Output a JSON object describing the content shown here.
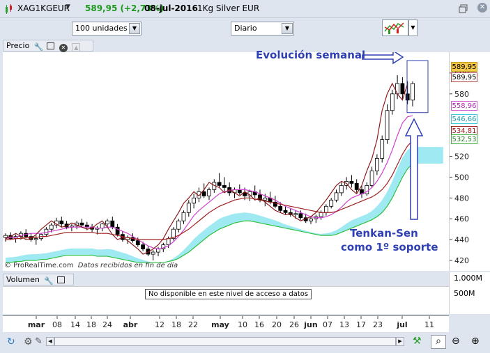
{
  "title": {
    "symbol": "XAG1KGEUR",
    "change": "589,95 (+2,73%)",
    "date": "08-jul-2016",
    "name": "1Kg Silver EUR"
  },
  "toolbar": {
    "units_select": "100 unidades",
    "period_select": "Diario"
  },
  "price_panel": {
    "label": "Precio",
    "watermark": "© ProRealTime.com",
    "watermark_note": "Datos recibidos en fin de día",
    "annotation_weekly": "Evolución semanal",
    "annotation_tenkan_line1": "Tenkan-Sen",
    "annotation_tenkan_line2": "como 1º soporte",
    "price_tags": [
      {
        "text": "589,95",
        "bg": "#f6c84a",
        "border": "#c89a1c",
        "color": "#000"
      },
      {
        "text": "589,95",
        "bg": "#ffffff",
        "border": "#b04848",
        "color": "#000"
      },
      {
        "text": "558,96",
        "bg": "#ffffff",
        "border": "#d060d0",
        "color": "#b030b0"
      },
      {
        "text": "546,66",
        "bg": "#ffffff",
        "border": "#40c8d8",
        "color": "#20a0b0"
      },
      {
        "text": "534,81",
        "bg": "#ffffff",
        "border": "#a02020",
        "color": "#a02020"
      },
      {
        "text": "532,53",
        "bg": "#ffffff",
        "border": "#40b040",
        "color": "#208020"
      }
    ]
  },
  "volume_panel": {
    "label": "Volumen",
    "message": "No disponible en este nivel de acceso a datos",
    "y_labels": [
      "1.000M",
      "500M"
    ]
  },
  "chart_data": {
    "type": "candlestick",
    "title": "",
    "ylim": [
      410,
      620
    ],
    "y_ticks": [
      420,
      440,
      460,
      480,
      500,
      520,
      580,
      600
    ],
    "x_ticks": [
      "mar",
      "08",
      "14",
      "18",
      "24",
      "abr",
      "12",
      "18",
      "22",
      "may",
      "10",
      "16",
      "20",
      "26",
      "jun",
      "07",
      "13",
      "17",
      "23",
      "jul",
      "11"
    ],
    "grid": false,
    "ohlc": [
      [
        442,
        446,
        438,
        444
      ],
      [
        444,
        447,
        440,
        441
      ],
      [
        441,
        445,
        437,
        443
      ],
      [
        443,
        448,
        440,
        446
      ],
      [
        446,
        450,
        441,
        443
      ],
      [
        443,
        446,
        438,
        440
      ],
      [
        440,
        444,
        435,
        441
      ],
      [
        441,
        446,
        439,
        445
      ],
      [
        445,
        452,
        443,
        450
      ],
      [
        450,
        456,
        447,
        454
      ],
      [
        454,
        461,
        451,
        458
      ],
      [
        458,
        462,
        452,
        455
      ],
      [
        455,
        458,
        450,
        452
      ],
      [
        452,
        455,
        448,
        453
      ],
      [
        453,
        458,
        450,
        456
      ],
      [
        456,
        460,
        452,
        454
      ],
      [
        454,
        457,
        449,
        452
      ],
      [
        452,
        455,
        447,
        450
      ],
      [
        450,
        453,
        445,
        451
      ],
      [
        451,
        456,
        448,
        455
      ],
      [
        455,
        460,
        452,
        458
      ],
      [
        458,
        462,
        450,
        452
      ],
      [
        452,
        455,
        443,
        445
      ],
      [
        445,
        448,
        438,
        440
      ],
      [
        440,
        444,
        436,
        442
      ],
      [
        442,
        446,
        437,
        439
      ],
      [
        439,
        442,
        433,
        435
      ],
      [
        435,
        438,
        429,
        431
      ],
      [
        431,
        434,
        424,
        426
      ],
      [
        426,
        430,
        420,
        428
      ],
      [
        428,
        433,
        424,
        431
      ],
      [
        431,
        437,
        428,
        435
      ],
      [
        435,
        443,
        432,
        441
      ],
      [
        441,
        452,
        439,
        450
      ],
      [
        450,
        460,
        447,
        458
      ],
      [
        458,
        468,
        455,
        466
      ],
      [
        466,
        478,
        462,
        475
      ],
      [
        475,
        484,
        470,
        480
      ],
      [
        480,
        490,
        476,
        486
      ],
      [
        486,
        494,
        480,
        482
      ],
      [
        482,
        490,
        478,
        488
      ],
      [
        488,
        498,
        485,
        495
      ],
      [
        495,
        504,
        490,
        492
      ],
      [
        492,
        500,
        486,
        490
      ],
      [
        490,
        495,
        482,
        485
      ],
      [
        485,
        490,
        480,
        488
      ],
      [
        488,
        493,
        483,
        485
      ],
      [
        485,
        490,
        478,
        482
      ],
      [
        482,
        488,
        477,
        486
      ],
      [
        486,
        492,
        480,
        483
      ],
      [
        483,
        488,
        476,
        478
      ],
      [
        478,
        484,
        472,
        480
      ],
      [
        480,
        486,
        474,
        476
      ],
      [
        476,
        482,
        470,
        472
      ],
      [
        472,
        476,
        466,
        468
      ],
      [
        468,
        472,
        464,
        466
      ],
      [
        466,
        470,
        462,
        464
      ],
      [
        464,
        468,
        460,
        465
      ],
      [
        465,
        468,
        459,
        461
      ],
      [
        461,
        465,
        456,
        458
      ],
      [
        458,
        462,
        455,
        460
      ],
      [
        460,
        464,
        456,
        462
      ],
      [
        462,
        468,
        459,
        466
      ],
      [
        466,
        474,
        463,
        472
      ],
      [
        472,
        480,
        470,
        478
      ],
      [
        478,
        488,
        476,
        485
      ],
      [
        485,
        495,
        482,
        492
      ],
      [
        492,
        500,
        488,
        496
      ],
      [
        496,
        502,
        490,
        494
      ],
      [
        494,
        498,
        485,
        488
      ],
      [
        488,
        492,
        480,
        484
      ],
      [
        484,
        495,
        482,
        492
      ],
      [
        492,
        510,
        490,
        506
      ],
      [
        506,
        522,
        502,
        518
      ],
      [
        518,
        540,
        514,
        536
      ],
      [
        536,
        570,
        532,
        564
      ],
      [
        564,
        584,
        560,
        580
      ],
      [
        580,
        598,
        575,
        590
      ],
      [
        590,
        596,
        575,
        580
      ],
      [
        580,
        592,
        570,
        574
      ],
      [
        574,
        592,
        568,
        590
      ]
    ],
    "series": [
      {
        "name": "Tenkan-Sen",
        "color": "#d040d0",
        "values": [
          441,
          442,
          442,
          444,
          445,
          446,
          446,
          446,
          447,
          448,
          449,
          450,
          451,
          452,
          452,
          452,
          452,
          452,
          451,
          451,
          452,
          452,
          450,
          448,
          446,
          443,
          440,
          437,
          434,
          432,
          431,
          432,
          434,
          438,
          443,
          449,
          456,
          463,
          468,
          472,
          476,
          480,
          484,
          486,
          487,
          488,
          488,
          488,
          487,
          486,
          484,
          482,
          480,
          478,
          475,
          472,
          470,
          468,
          466,
          464,
          462,
          461,
          461,
          462,
          464,
          467,
          471,
          476,
          480,
          482,
          484,
          486,
          490,
          496,
          504,
          514,
          526,
          540,
          552,
          558,
          559
        ]
      },
      {
        "name": "Kijun-Sen",
        "color": "#a02020",
        "values": [
          440,
          440,
          441,
          441,
          442,
          442,
          442,
          443,
          443,
          444,
          445,
          446,
          447,
          447,
          447,
          447,
          447,
          447,
          446,
          446,
          446,
          445,
          444,
          443,
          442,
          441,
          440,
          440,
          440,
          440,
          440,
          440,
          441,
          442,
          444,
          447,
          450,
          454,
          458,
          462,
          466,
          469,
          472,
          474,
          476,
          478,
          479,
          480,
          480,
          479,
          478,
          477,
          476,
          475,
          474,
          473,
          472,
          471,
          470,
          469,
          468,
          467,
          466,
          466,
          466,
          467,
          469,
          471,
          473,
          475,
          477,
          479,
          481,
          484,
          488,
          494,
          502,
          512,
          522,
          530,
          535
        ]
      },
      {
        "name": "Chikou",
        "color": "#8b1a1a",
        "values": [
          441,
          443,
          446,
          443,
          440,
          441,
          445,
          450,
          454,
          458,
          455,
          452,
          453,
          456,
          454,
          452,
          450,
          451,
          455,
          458,
          452,
          445,
          440,
          442,
          439,
          435,
          431,
          426,
          428,
          431,
          435,
          441,
          450,
          458,
          466,
          475,
          480,
          486,
          482,
          488,
          495,
          492,
          490,
          485,
          488,
          485,
          482,
          486,
          483,
          478,
          480,
          476,
          472,
          468,
          466,
          464,
          465,
          461,
          458,
          460,
          462,
          466,
          472,
          478,
          485,
          492,
          496,
          494,
          488,
          484,
          492,
          506,
          518,
          536,
          564,
          580,
          590,
          580,
          574,
          590,
          null
        ]
      }
    ]
  }
}
